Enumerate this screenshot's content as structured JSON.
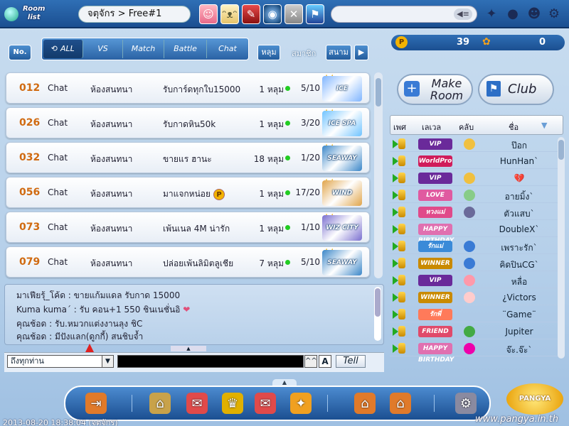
{
  "top": {
    "logo_line1": "Room",
    "logo_line2": "list",
    "breadcrumb": "จตุจักร > Free#1",
    "avatar_icons": [
      "character-avatar-icon",
      "cat-avatar-icon",
      "item-icon",
      "globe-icon",
      "close-icon",
      "caddie-icon"
    ],
    "system_icons": [
      "sparkle-icon",
      "chat-bubble-icon",
      "info-icon",
      "settings-gear-icon"
    ]
  },
  "filter": {
    "no_label": "No.",
    "tabs": [
      "ALL",
      "VS",
      "Match",
      "Battle",
      "Chat"
    ],
    "active_tab": "ALL",
    "hole_label": "หลุม",
    "member_label": "สมาชิก",
    "course_label": "สนาม",
    "next_label": "▶"
  },
  "points": {
    "pang": "39",
    "cookie": "0"
  },
  "rooms": [
    {
      "num": "012",
      "type": "Chat",
      "lobby": "ห้องสนทนา",
      "name": "รับการ์ดทุกใบ15000",
      "holes": "1 หลุม",
      "players": "5/10",
      "course": "ICE CANNON",
      "coin": false
    },
    {
      "num": "026",
      "type": "Chat",
      "lobby": "ห้องสนทนา",
      "name": "รับกาดหิน50k",
      "holes": "1 หลุม",
      "players": "3/20",
      "course": "ICE SPA",
      "coin": false
    },
    {
      "num": "032",
      "type": "Chat",
      "lobby": "ห้องสนทนา",
      "name": "ขายแร ฮานะ",
      "holes": "18 หลุม",
      "players": "1/20",
      "course": "SEAWAY",
      "coin": false
    },
    {
      "num": "056",
      "type": "Chat",
      "lobby": "ห้องสนทนา",
      "name": "มาแจกหน่อย",
      "holes": "1 หลุม",
      "players": "17/20",
      "course": "WIND",
      "coin": true
    },
    {
      "num": "073",
      "type": "Chat",
      "lobby": "ห้องสนทนา",
      "name": "เพ้นเนล 4M น่ารัก",
      "holes": "1 หลุม",
      "players": "1/10",
      "course": "WIZ CITY",
      "coin": false
    },
    {
      "num": "079",
      "type": "Chat",
      "lobby": "ห้องสนทนา",
      "name": "ปล่อยเพ้นลิมิตลูเชีย",
      "holes": "7 หลุม",
      "players": "5/10",
      "course": "SEAWAY",
      "coin": false
    }
  ],
  "chat": [
    "มาเฟียรุ้_โค้ด : ขายแก้มแดล รับกาด 15000",
    "Kuma kuma´ : รับ  คอน+1 550  ชินเนชั่นอิ",
    "คุณช้อด : รับ.หมวกแต่งงานลุง ชิC",
    "คุณช้อด : มีปังแลก(ดูกกี้) สนชิบจ้ำ"
  ],
  "chat_controls": {
    "target": "ถึงทุกท่าน",
    "font_caret": "^^",
    "font_a": "A",
    "tell": "Tell"
  },
  "right": {
    "make_room_line1": "Make",
    "make_room_line2": "Room",
    "club": "Club",
    "headers": [
      "เพศ",
      "เลเวล",
      "คลับ",
      "ชื่อ"
    ]
  },
  "users": [
    {
      "level": "VIP",
      "name": "ป๊อก"
    },
    {
      "level": "WorldPro",
      "name": "HunHan`"
    },
    {
      "level": "VIP",
      "name": "💔"
    },
    {
      "level": "LOVE",
      "name": "อายมิ้ง`"
    },
    {
      "level": "หวงแม่",
      "name": "ตัวแสบ`"
    },
    {
      "level": "HAPPY BIRTHDAY",
      "name": "DoubleX`"
    },
    {
      "level": "รักแม่",
      "name": "เพราะรัก`"
    },
    {
      "level": "WINNER",
      "name": "คิดปินCG`"
    },
    {
      "level": "VIP",
      "name": "หลื่อ"
    },
    {
      "level": "WINNER",
      "name": "¿Victors"
    },
    {
      "level": "รักพี่",
      "name": "¨Game¨"
    },
    {
      "level": "FRIEND",
      "name": "Jupiter"
    },
    {
      "level": "HAPPY BIRTHDAY",
      "name": "จ๊ะ.จ๊ะ`"
    }
  ],
  "bottom_icons": [
    "exit-door-icon",
    "shop-icon",
    "gift-icon",
    "trophy-icon",
    "mail-icon",
    "scratch-icon",
    "home-icon",
    "house-icon",
    "plugin-icon"
  ],
  "footer": {
    "datetime": "2013-08-20 18:38:04 (จตุจักร)",
    "site": "www.pangya.in.th",
    "logo": "PANGYA"
  },
  "colors": {
    "accent": "#1b4f91",
    "room_number": "#d06a10",
    "online_dot": "#22cc22"
  }
}
